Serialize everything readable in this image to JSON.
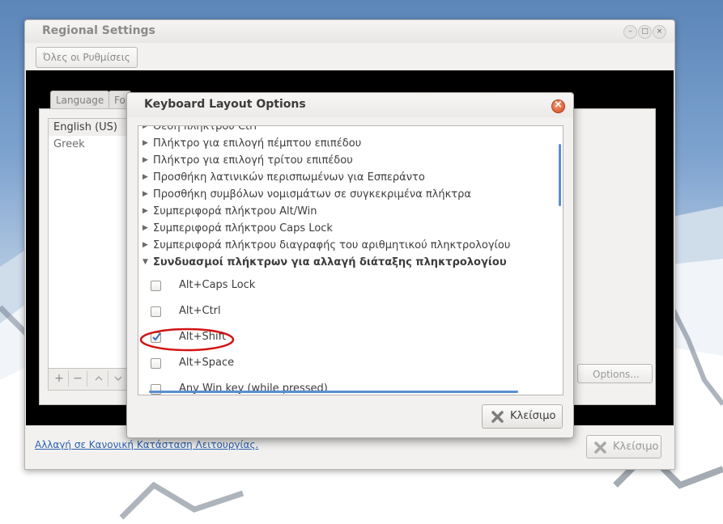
{
  "main_window": {
    "title": "Regional Settings",
    "all_settings_label": "Όλες οι Ρυθμίσεις",
    "tabs": [
      "Language",
      "Fo"
    ],
    "languages": [
      "English (US)",
      "Greek"
    ],
    "options_label": "Options...",
    "footer_link": "Αλλαγή  σε Κανονική Κατάσταση Λειτουργίας.",
    "close_label": "Κλείσιμο",
    "toolbar": {
      "add": "+",
      "remove": "−",
      "up": "^",
      "down": "v"
    }
  },
  "dialog": {
    "title": "Keyboard Layout Options",
    "close_label": "Κλείσιμο",
    "groups": [
      "Θέση πλήκτρου Ctrl",
      "Πλήκτρο για επιλογή πέμπτου επιπέδου",
      "Πλήκτρο για επιλογή τρίτου επιπέδου",
      "Προσθήκη λατινικών περισπωμένων για Εσπεράντο",
      "Προσθήκη συμβόλων νομισμάτων σε συγκεκριμένα πλήκτρα",
      "Συμπεριφορά πλήκτρου Alt/Win",
      "Συμπεριφορά πλήκτρου Caps Lock",
      "Συμπεριφορά πλήκτρου διαγραφής του αριθμητικού πληκτρολογίου"
    ],
    "expanded_group": "Συνδυασμοί πλήκτρων για αλλαγή διάταξης πληκτρολογίου",
    "options": [
      {
        "label": "Alt+Caps Lock",
        "checked": false
      },
      {
        "label": "Alt+Ctrl",
        "checked": false
      },
      {
        "label": "Alt+Shift",
        "checked": true
      },
      {
        "label": "Alt+Space",
        "checked": false
      },
      {
        "label": "Any Win key (while pressed)",
        "checked": false
      }
    ]
  },
  "colors": {
    "highlight_ring": "#d21414",
    "link": "#2c62b0",
    "scrollbar": "#5b8fd0"
  }
}
